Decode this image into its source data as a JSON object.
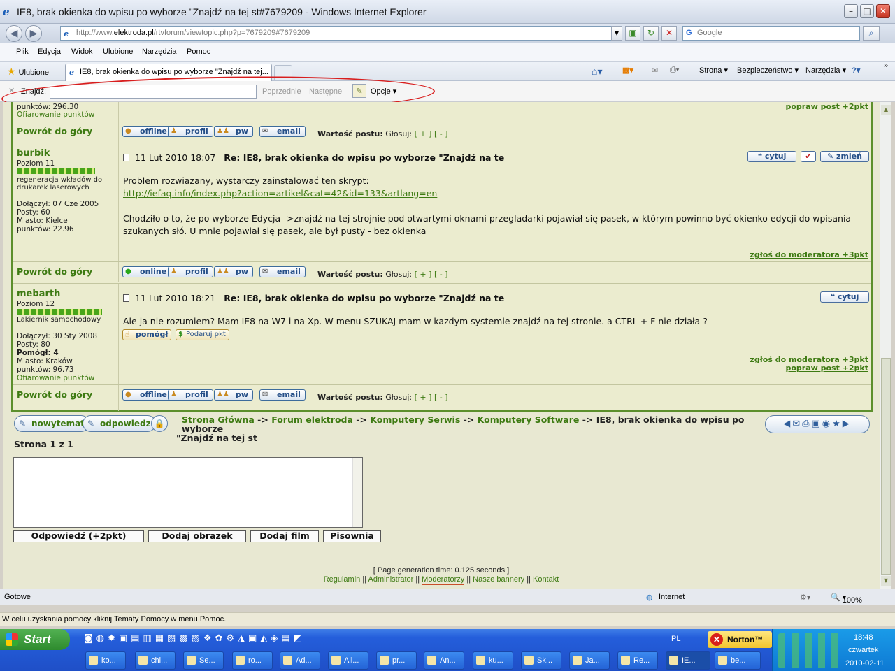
{
  "window": {
    "title": "IE8, brak okienka do wpisu po wyborze \"Znajdź na tej st#7679209 - Windows Internet Explorer",
    "min": "–",
    "max": "□",
    "close": "✕"
  },
  "address": {
    "prefix": "http://www.",
    "host": "elektroda.pl",
    "path": "/rtvforum/viewtopic.php?p=7679209#7679209",
    "search_placeholder": "Google"
  },
  "menu": [
    "Plik",
    "Edycja",
    "Widok",
    "Ulubione",
    "Narzędzia",
    "Pomoc"
  ],
  "tabbar": {
    "favorites": "Ulubione",
    "tab_title": "IE8, brak okienka do wpisu po wyborze \"Znajdź na tej...",
    "commands": [
      "Strona ▾",
      "Bezpieczeństwo ▾",
      "Narzędzia ▾"
    ]
  },
  "findbar": {
    "label": "Znajdź:",
    "value": "",
    "prev": "Poprzednie",
    "next": "Następne",
    "options": "Opcje"
  },
  "top_partial": {
    "punkty": "punktów: 296.30",
    "ofiarowanie": "Ofiarowanie punktów",
    "edit_link": "popraw post +2pkt"
  },
  "common": {
    "back_to_top": "Powrót do góry",
    "profile": "profil",
    "pm": "pw",
    "email": "email",
    "vote_label": "Wartość postu:",
    "vote_text": "Głosuj:",
    "vote_plus": "[ + ]",
    "vote_minus": "[ - ]",
    "quote": "cytuj",
    "edit": "zmień",
    "report": "zgłoś do moderatora +3pkt",
    "edit_post": "popraw post +2pkt"
  },
  "status_labels": {
    "offline": "offline",
    "online": "online"
  },
  "posts": [
    {
      "author": "burbik",
      "level": "Poziom 11",
      "title_line1": "regeneracja wkładów do",
      "title_line2": "drukarek laserowych",
      "joined": "Dołączył: 07 Cze 2005",
      "posts": "Posty: 60",
      "city": "Miasto: Kielce",
      "points": "punktów: 22.96",
      "date": "11 Lut 2010 18:07",
      "subject": "Re: IE8, brak okienka do wpisu po wyborze \"Znajdź na te",
      "body1": "Problem rozwiazany, wystarczy zainstalować ten skrypt:",
      "link": "http://iefaq.info/index.php?action=artikel&cat=42&id=133&artlang=en",
      "body2": "Chodziło o to, że po wyborze Edycja-->znajdź na tej strojnie pod otwartymi oknami przegladarki pojawiał się pasek, w którym powinno być okienko edycji do wpisania szukanych słó. U mnie pojawiał się pasek, ale był pusty - bez okienka"
    },
    {
      "author": "mebarth",
      "level": "Poziom 12",
      "title_line1": "Lakiernik samochodowy",
      "joined": "Dołączył: 30 Sty 2008",
      "posts": "Posty: 80",
      "helped": "Pomógł: 4",
      "city": "Miasto: Kraków",
      "points": "punktów: 96.73",
      "ofiarowanie": "Ofiarowanie punktów",
      "date": "11 Lut 2010 18:21",
      "subject": "Re: IE8, brak okienka do wpisu po wyborze \"Znajdź na te",
      "body1": "Ale ja nie rozumiem? Mam IE8 na W7 i na Xp. W menu SZUKAJ mam w kazdym systemie znajdź na tej stronie. a CTRL + F nie działa ?",
      "helped_btn": "pomógł",
      "give_points": "Podaruj pkt"
    }
  ],
  "actions": {
    "new_topic": "nowytemat",
    "reply": "odpowiedz",
    "breadcrumb": [
      "Strona Główna",
      "Forum elektroda",
      "Komputery Serwis",
      "Komputery Software"
    ],
    "breadcrumb_sep": "->",
    "topic_line1": "IE8, brak okienka do wpisu po wyborze",
    "topic_line2": "\"Znajdź na tej st",
    "page": "Strona 1 z 1"
  },
  "reply_buttons": [
    "Odpowiedź (+2pkt)",
    "Dodaj obrazek",
    "Dodaj film",
    "Pisownia"
  ],
  "footer": {
    "gen_time": "[ Page generation time: 0.125 seconds ]",
    "links": [
      "Regulamin",
      "Administrator",
      "Moderatorzy",
      "Nasze bannery",
      "Kontakt"
    ],
    "sep": "||"
  },
  "statusbar": {
    "left": "Gotowe",
    "zone": "Internet",
    "zoom": "100%"
  },
  "hint": "W celu uzyskania pomocy kliknij Tematy Pomocy w menu Pomoc.",
  "taskbar": {
    "start": "Start",
    "lang": "PL",
    "norton": "Norton™",
    "buttons": [
      "ko...",
      "chi...",
      "Se...",
      "ro...",
      "Ad...",
      "All...",
      "pr...",
      "An...",
      "ku...",
      "Sk...",
      "Ja...",
      "Re...",
      "IE...",
      "be..."
    ],
    "time": "18:48",
    "day": "czwartek",
    "date": "2010-02-11"
  }
}
